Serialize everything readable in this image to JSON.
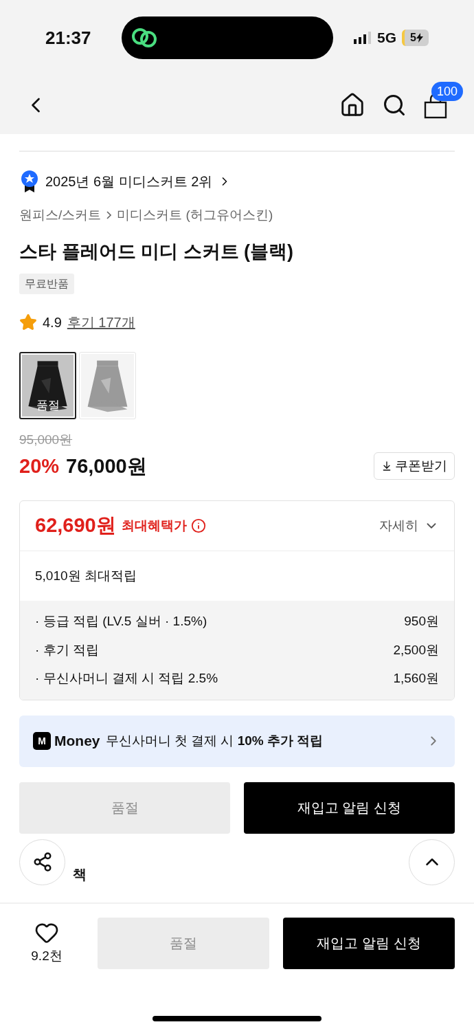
{
  "status_bar": {
    "time": "21:37",
    "network": "5G",
    "battery": "5"
  },
  "nav": {
    "cart_count": "100"
  },
  "ranking": {
    "text": "2025년 6월 미디스커트 2위"
  },
  "breadcrumb": [
    {
      "label": "원피스/스커트"
    },
    {
      "label": "미디스커트 (허그유어스킨)"
    }
  ],
  "product": {
    "title": "스타 플레어드 미디 스커트 (블랙)",
    "tags": [
      "무료반품"
    ],
    "rating": "4.9",
    "reviews": "후기 177개"
  },
  "variants": [
    {
      "selected": true,
      "badge": "품절"
    },
    {
      "selected": false
    }
  ],
  "price": {
    "original": "95,000원",
    "discount": "20%",
    "sale": "76,000원",
    "coupon_button": "쿠폰받기"
  },
  "benefits": {
    "max_price": "62,690원",
    "max_label": "최대혜택가",
    "details": "자세히",
    "max_points": "5,010원 최대적립",
    "items": [
      {
        "label": "· 등급 적립 (LV.5 실버 · 1.5%)",
        "value": "950원"
      },
      {
        "label": "· 후기 적립",
        "value": "2,500원"
      },
      {
        "label": "· 무신사머니 결제 시 적립 2.5%",
        "value": "1,560원"
      }
    ]
  },
  "money_banner": {
    "logo": "M",
    "brand": "Money",
    "text": "무신사머니 첫 결제 시 **10% 추가 적립**"
  },
  "actions": [
    {
      "label": "품절",
      "disabled": true
    },
    {
      "label": "재입고 알림 신청",
      "disabled": false
    }
  ],
  "section_fragment": "책",
  "bottom_bar": {
    "likes": "9.2천",
    "liked": false,
    "actions": [
      {
        "label": "품절",
        "disabled": true
      },
      {
        "label": "재입고 알림 신청",
        "disabled": false
      }
    ]
  }
}
